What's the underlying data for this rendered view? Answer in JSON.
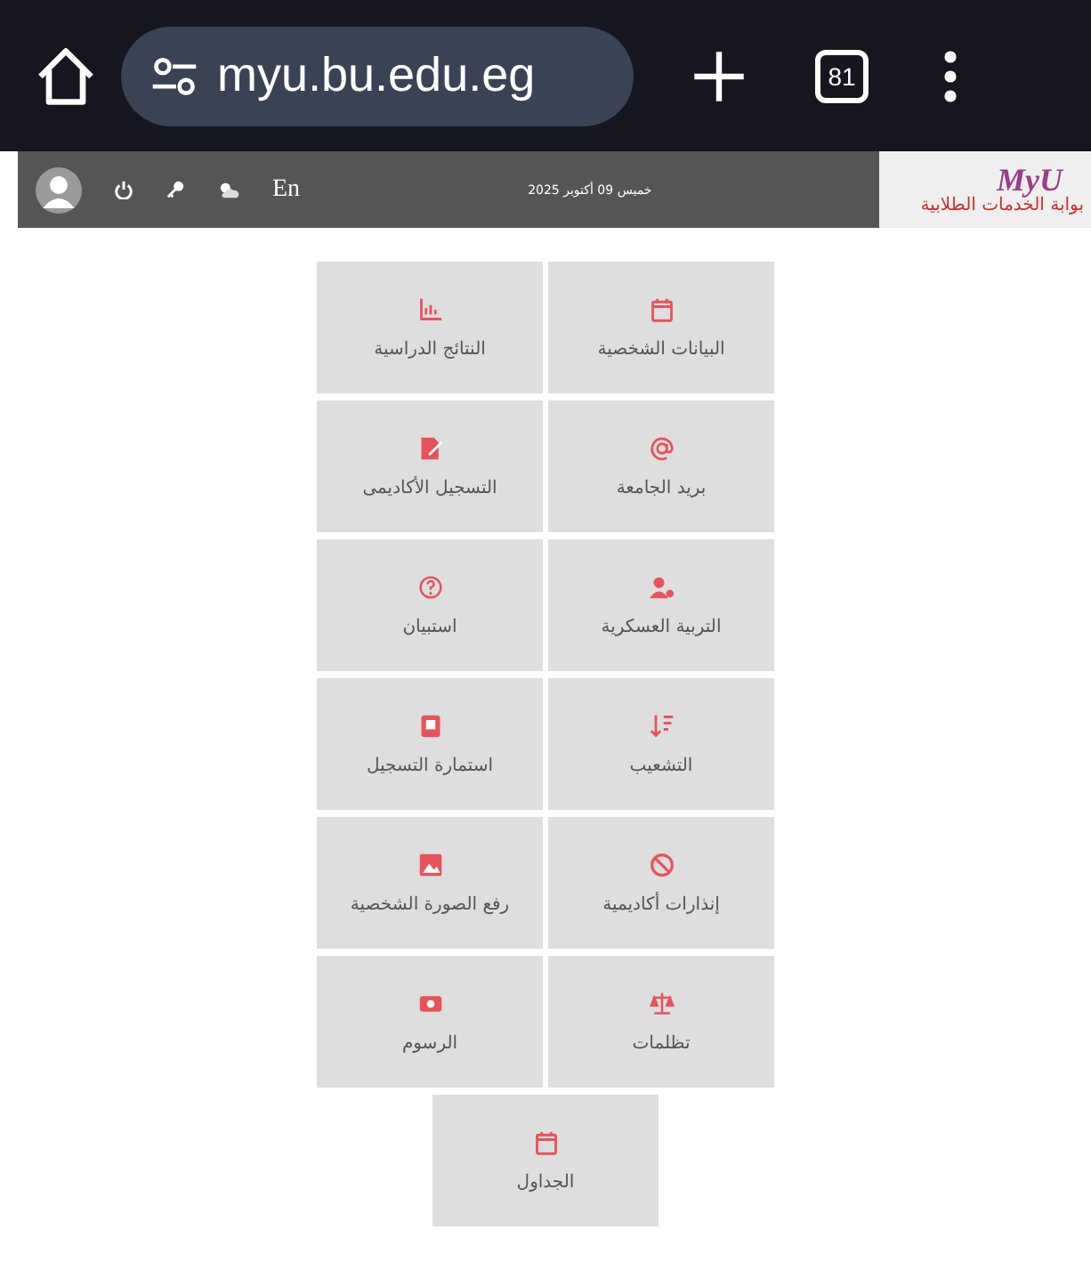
{
  "browser": {
    "url": "myu.bu.edu.eg",
    "tab_count": "81"
  },
  "header": {
    "language": "En",
    "date": "خميس 09 أكتوبر 2025",
    "logo": {
      "mark": "MyU",
      "subtitle": "بوابة الخدمات الطلابية"
    }
  },
  "tiles": [
    {
      "label": "البيانات الشخصية"
    },
    {
      "label": "النتائج الدراسية"
    },
    {
      "label": "بريد الجامعة"
    },
    {
      "label": "التسجيل الأكاديمى"
    },
    {
      "label": "التربية العسكرية"
    },
    {
      "label": "استبيان"
    },
    {
      "label": "التشعيب"
    },
    {
      "label": "استمارة التسجيل"
    },
    {
      "label": "إنذارات أكاديمية"
    },
    {
      "label": "رفع الصورة الشخصية"
    },
    {
      "label": "تظلمات"
    },
    {
      "label": "الرسوم"
    },
    {
      "label": "الجداول"
    }
  ]
}
